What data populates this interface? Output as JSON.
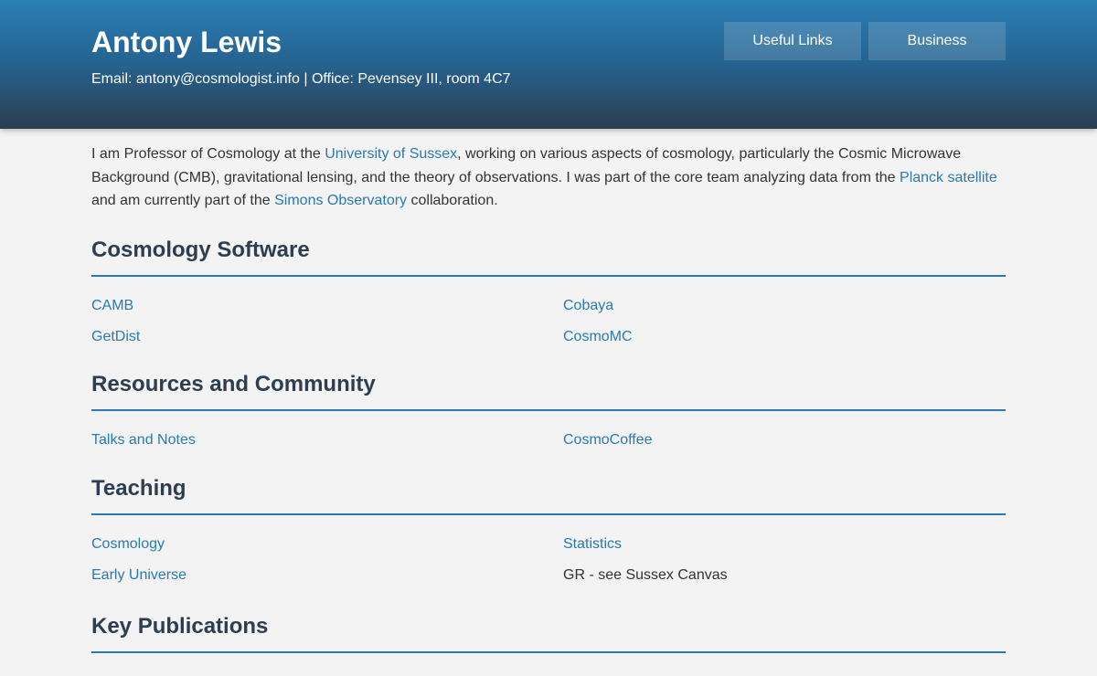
{
  "header": {
    "name": "Antony Lewis",
    "contact": "Email: antony@cosmologist.info | Office: Pevensey III, room 4C7",
    "nav": [
      "Useful Links",
      "Business"
    ]
  },
  "intro": {
    "t1": "I am Professor of Cosmology at the ",
    "link1": "University of Sussex",
    "t2": ", working on various aspects of cosmology, particularly the Cosmic Microwave Background (CMB), gravitational lensing, and the theory of observations. I was part of the core team analyzing data from the ",
    "link2": "Planck satellite",
    "t3": " and am currently part of the ",
    "link3": "Simons Observatory",
    "t4": " collaboration."
  },
  "sections": {
    "software": {
      "title": "Cosmology Software",
      "items": [
        "CAMB",
        "Cobaya",
        "GetDist",
        "CosmoMC"
      ]
    },
    "resources": {
      "title": "Resources and Community",
      "items": [
        "Talks and Notes",
        "CosmoCoffee"
      ]
    },
    "teaching": {
      "title": "Teaching",
      "items": [
        "Cosmology",
        "Statistics",
        "Early Universe",
        "GR - see Sussex Canvas"
      ]
    },
    "publications": {
      "title": "Key Publications"
    }
  },
  "colors": {
    "link": "#2a7ab0",
    "heading": "#2c3e50",
    "background": "#f3f3f3",
    "header_top": "#2b7fb6",
    "header_bottom": "#2d3e50"
  }
}
